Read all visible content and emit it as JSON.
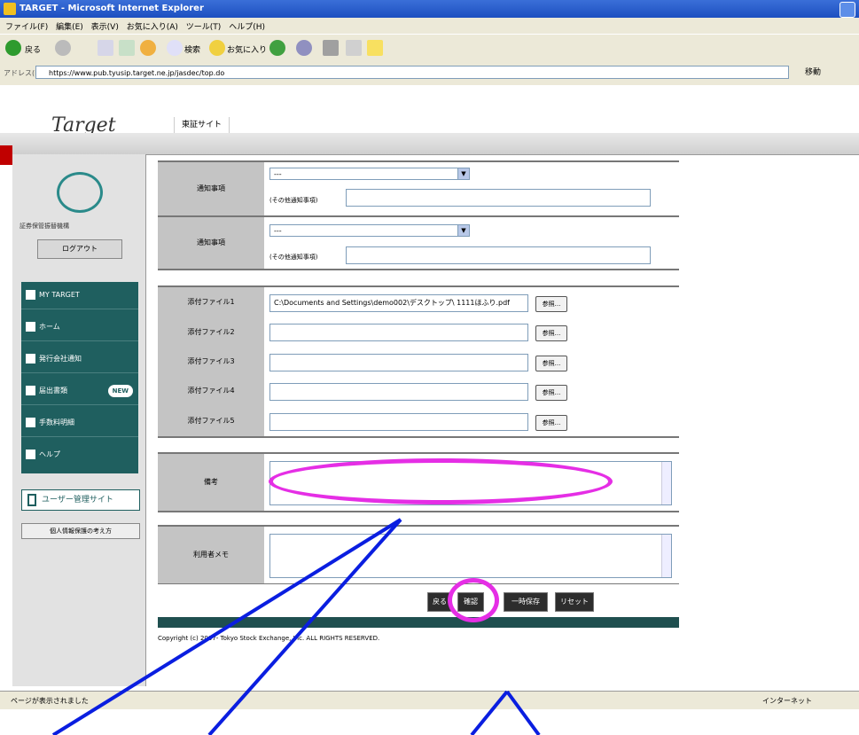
{
  "window": {
    "title": "TARGET - Microsoft Internet Explorer"
  },
  "menu": [
    "ファイル(F)",
    "編集(E)",
    "表示(V)",
    "お気に入り(A)",
    "ツール(T)",
    "ヘルプ(H)"
  ],
  "toolbar": {
    "back_label": "戻る",
    "search_label": "検索",
    "favorites_label": "お気に入り"
  },
  "address": {
    "label": "アドレス(D)",
    "url": "https://www.pub.tyusip.target.ne.jp/jasdec/top.do",
    "go_label": "移動"
  },
  "site": {
    "logo": "Target",
    "tab": "東証サイト"
  },
  "sidebar": {
    "org": "証券保管振替機構",
    "logout": "ログアウト",
    "nav": [
      {
        "label": "MY TARGET"
      },
      {
        "label": "ホーム"
      },
      {
        "label": "発行会社通知"
      },
      {
        "label": "届出書類",
        "badge": "NEW"
      },
      {
        "label": "手数料明細"
      },
      {
        "label": "ヘルプ"
      }
    ],
    "user_site": "ユーザー管理サイト",
    "privacy": "個人情報保護の考え方"
  },
  "form": {
    "notice1": {
      "label": "通知事項",
      "select": "---",
      "other_label": "(その他通知事項)",
      "other_value": ""
    },
    "notice2": {
      "label": "通知事項",
      "select": "---",
      "other_label": "(その他通知事項)",
      "other_value": ""
    },
    "attachments": [
      {
        "label": "添付ファイル1",
        "value": "C:\\Documents and Settings\\demo002\\デスクトップ\\ 1111ほふり.pdf",
        "browse": "参照..."
      },
      {
        "label": "添付ファイル2",
        "value": "",
        "browse": "参照..."
      },
      {
        "label": "添付ファイル3",
        "value": "",
        "browse": "参照..."
      },
      {
        "label": "添付ファイル4",
        "value": "",
        "browse": "参照..."
      },
      {
        "label": "添付ファイル5",
        "value": "",
        "browse": "参照..."
      }
    ],
    "remarks_label": "備考",
    "memo_label": "利用者メモ"
  },
  "buttons": {
    "back": "戻る",
    "confirm": "確認",
    "save": "一時保存",
    "reset": "リセット"
  },
  "footer": {
    "copyright": "Copyright (c) 2007- Tokyo Stock Exchange, Inc. ALL RIGHTS RESERVED."
  },
  "status": {
    "left": "ページが表示されました",
    "right": "インターネット"
  },
  "colors": {
    "sidebar_nav": "#1f5f5f",
    "annotation_ellipse": "#e52ee5",
    "annotation_arrow": "#0a1ee0"
  }
}
